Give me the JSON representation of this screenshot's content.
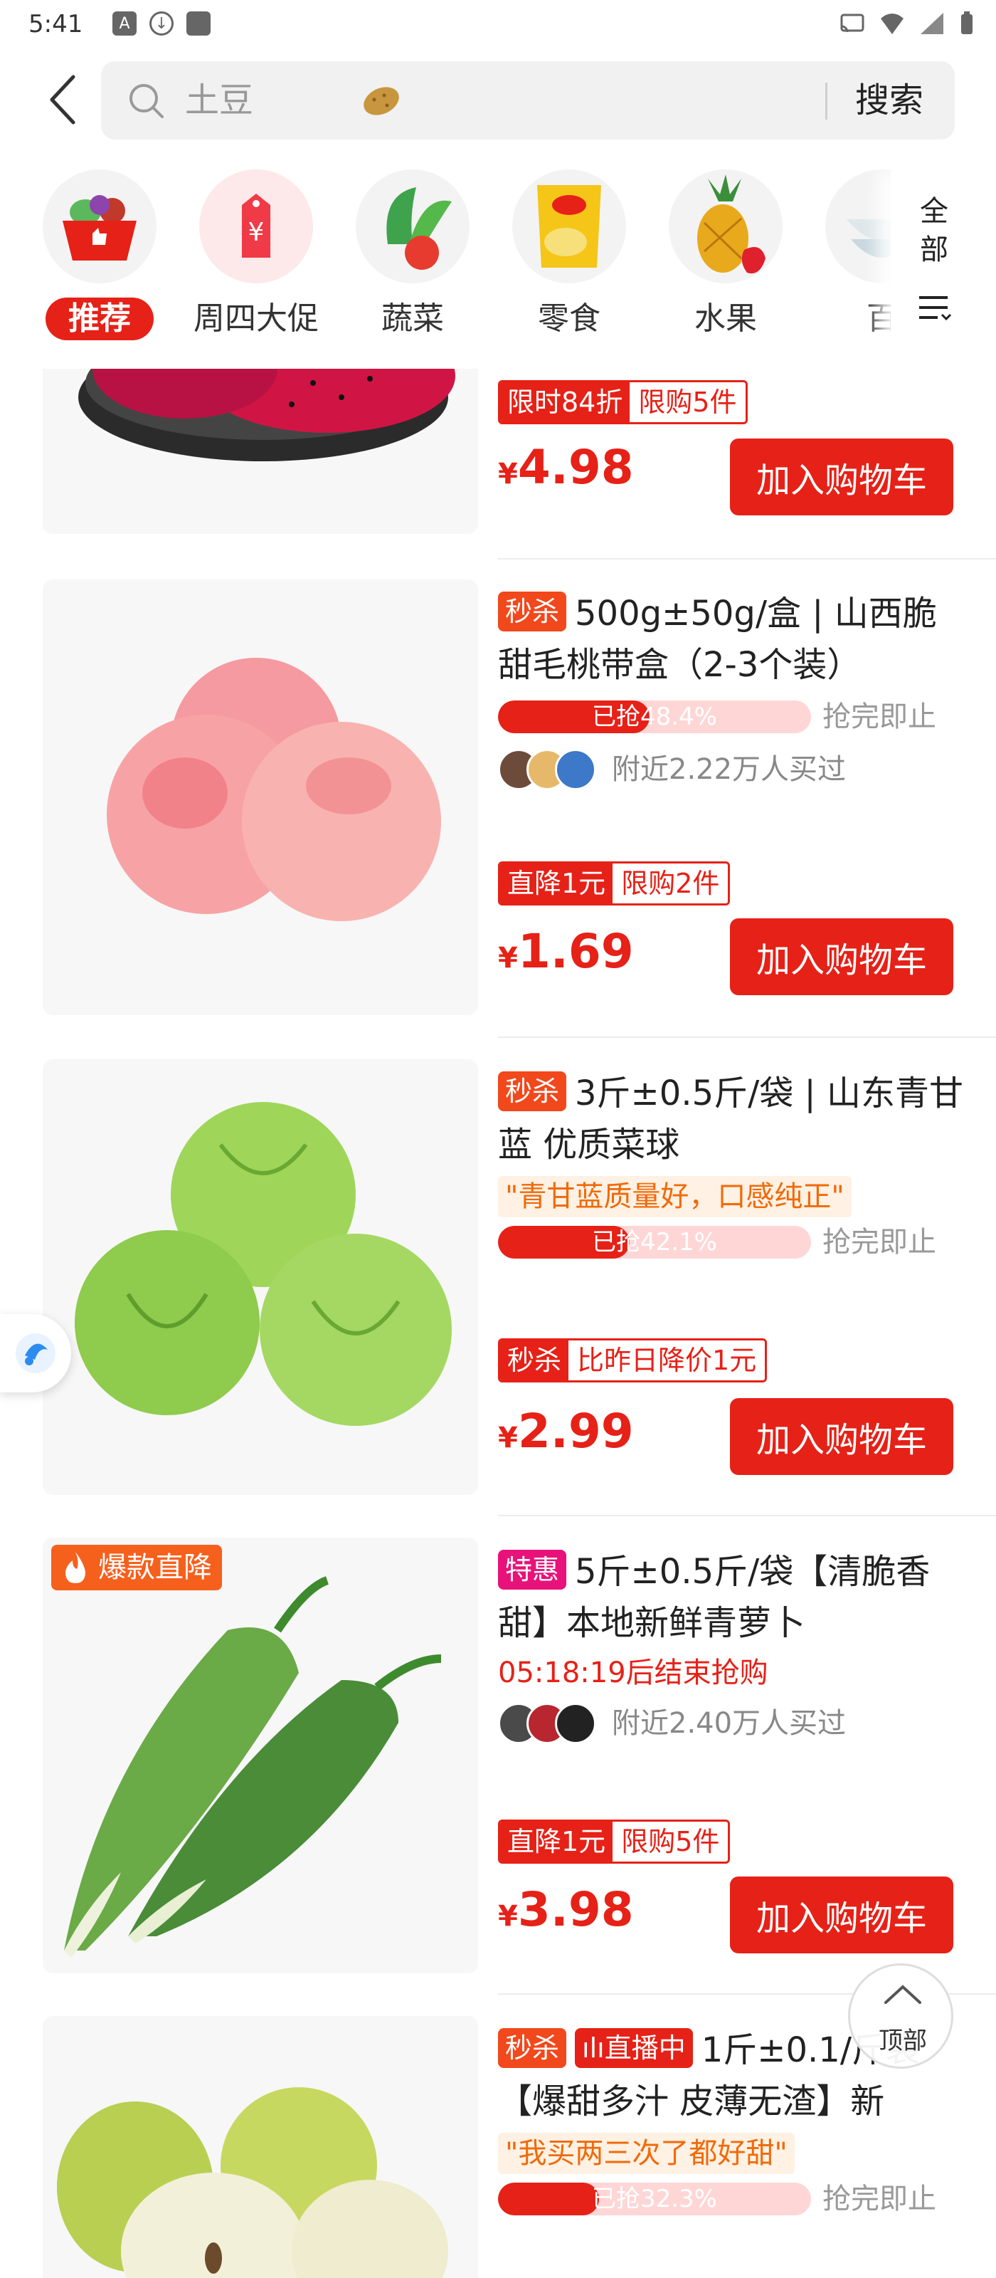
{
  "status_bar": {
    "time": "5:41"
  },
  "search": {
    "placeholder": "土豆",
    "button": "搜索"
  },
  "categories": [
    {
      "label": "推荐",
      "icon": "basket-thumb-icon",
      "active": true
    },
    {
      "label": "周四大促",
      "icon": "price-tag-icon"
    },
    {
      "label": "蔬菜",
      "icon": "vegetables-icon"
    },
    {
      "label": "零食",
      "icon": "chips-bag-icon"
    },
    {
      "label": "水果",
      "icon": "pineapple-icon"
    },
    {
      "label": "百",
      "icon": "bowls-icon"
    }
  ],
  "category_all": "全部",
  "products": [
    {
      "promo_a": "限时84折",
      "promo_b": "限购5件",
      "price": "4.98",
      "currency": "¥",
      "cart": "加入购物车"
    },
    {
      "tag": "秒杀",
      "title": "500g±50g/盒 | 山西脆甜毛桃带盒（2-3个装）",
      "progress_text": "已抢48.4%",
      "progress": 0.484,
      "progress_side": "抢完即止",
      "buyers": "附近2.22万人买过",
      "promo_a": "直降1元",
      "promo_b": "限购2件",
      "price": "1.69",
      "currency": "¥",
      "cart": "加入购物车"
    },
    {
      "tag": "秒杀",
      "title": "3斤±0.5斤/袋 | 山东青甘蓝 优质菜球",
      "quote": "\"青甘蓝质量好，口感纯正\"",
      "progress_text": "已抢42.1%",
      "progress": 0.421,
      "progress_side": "抢完即止",
      "promo_a": "秒杀",
      "promo_b": "比昨日降价1元",
      "price": "2.99",
      "currency": "¥",
      "cart": "加入购物车"
    },
    {
      "badge": "爆款直降",
      "tag": "特惠",
      "title": "5斤±0.5斤/袋【清脆香甜】本地新鲜青萝卜",
      "countdown": "05:18:19后结束抢购",
      "buyers": "附近2.40万人买过",
      "promo_a": "直降1元",
      "promo_b": "限购5件",
      "price": "3.98",
      "currency": "¥",
      "cart": "加入购物车"
    },
    {
      "tag": "秒杀",
      "live": "直播中",
      "title": "1斤±0.1/斤袋【爆甜多汁 皮薄无渣】新",
      "quote": "\"我买两三次了都好甜\"",
      "progress_text": "已抢32.3%",
      "progress": 0.323,
      "progress_side": "抢完即止"
    }
  ],
  "top_button": "顶部",
  "colors": {
    "accent": "#e62117",
    "progress_bg": "#ffd6d6",
    "quote_bg": "#fff1e3",
    "quote_text": "#f06a0a"
  }
}
